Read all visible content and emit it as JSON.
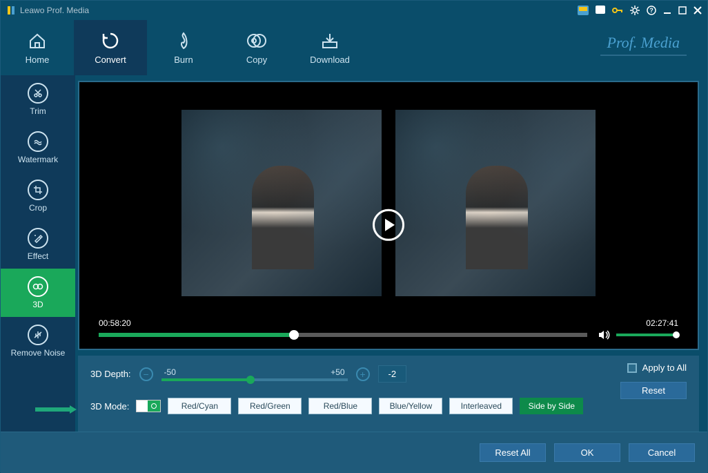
{
  "app": {
    "title": "Leawo Prof. Media",
    "brand": "Prof. Media"
  },
  "topnav": {
    "items": [
      {
        "label": "Home"
      },
      {
        "label": "Convert"
      },
      {
        "label": "Burn"
      },
      {
        "label": "Copy"
      },
      {
        "label": "Download"
      }
    ]
  },
  "sidebar": {
    "items": [
      {
        "label": "Trim"
      },
      {
        "label": "Watermark"
      },
      {
        "label": "Crop"
      },
      {
        "label": "Effect"
      },
      {
        "label": "3D"
      },
      {
        "label": "Remove Noise"
      }
    ]
  },
  "player": {
    "current_time": "00:58:20",
    "total_time": "02:27:41",
    "progress_pct": 40,
    "volume_pct": 100
  },
  "three_d": {
    "depth_label": "3D Depth:",
    "depth_min": "-50",
    "depth_max": "+50",
    "depth_value": "-2",
    "mode_label": "3D Mode:",
    "modes": [
      {
        "label": "Red/Cyan"
      },
      {
        "label": "Red/Green"
      },
      {
        "label": "Red/Blue"
      },
      {
        "label": "Blue/Yellow"
      },
      {
        "label": "Interleaved"
      },
      {
        "label": "Side by Side"
      }
    ],
    "apply_all": "Apply to All",
    "reset": "Reset"
  },
  "footer": {
    "reset_all": "Reset All",
    "ok": "OK",
    "cancel": "Cancel"
  }
}
